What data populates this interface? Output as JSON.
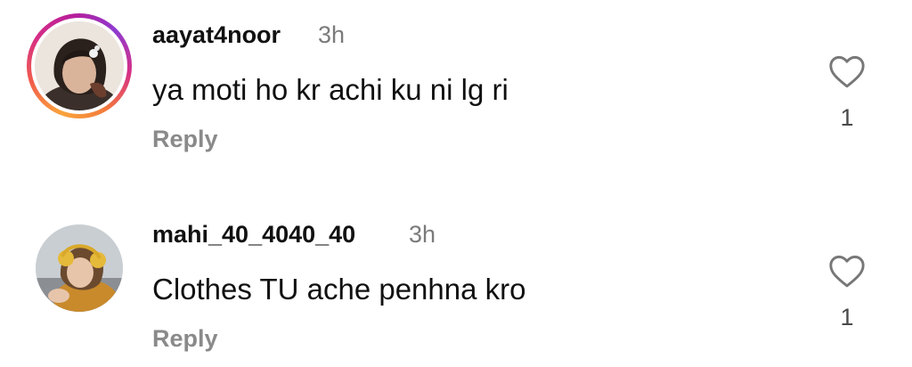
{
  "comments": [
    {
      "username": "aayat4noor",
      "time": "3h",
      "text": "ya moti ho kr achi ku ni lg ri",
      "reply_label": "Reply",
      "likes": "1",
      "like_icon": "heart-outline-icon",
      "has_story_ring": true
    },
    {
      "username": "mahi_40_4040_40",
      "time": "3h",
      "text": "Clothes TU ache penhna kro",
      "reply_label": "Reply",
      "likes": "1",
      "like_icon": "heart-outline-icon",
      "has_story_ring": false
    }
  ],
  "colors": {
    "text_primary": "#111111",
    "text_secondary": "#8a8a8a",
    "story_ring": [
      "#f9a43b",
      "#d62f86",
      "#8f3bd0"
    ]
  }
}
